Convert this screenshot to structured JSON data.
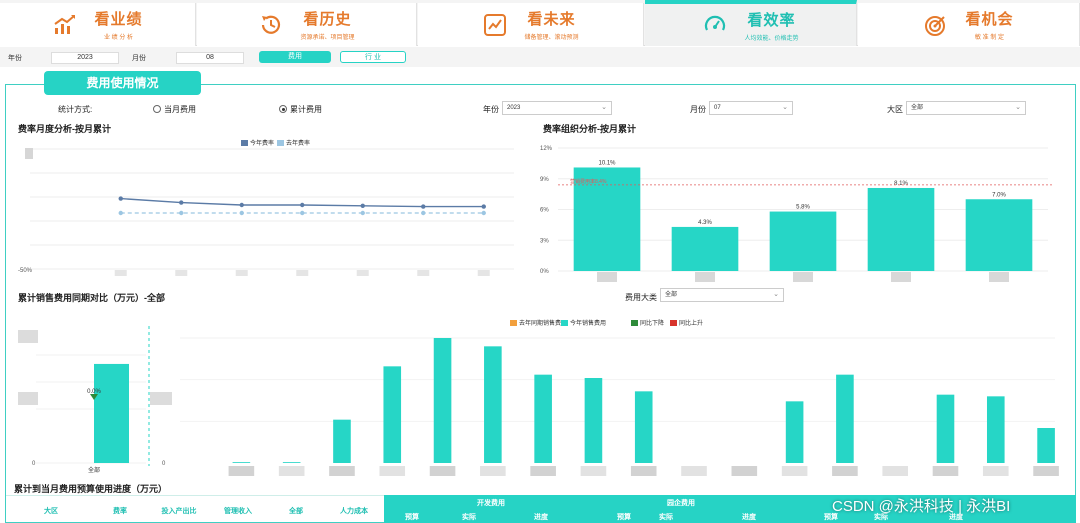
{
  "nav": {
    "tabs": [
      {
        "title": "看业绩",
        "subtitle": "业 绩 分 析",
        "icon": "bar-growth-icon",
        "active": false
      },
      {
        "title": "看历史",
        "subtitle": "资源承诺、项目管理",
        "icon": "history-icon",
        "active": false
      },
      {
        "title": "看未来",
        "subtitle": "储备管理、滚动预测",
        "icon": "trend-icon",
        "active": false
      },
      {
        "title": "看效率",
        "subtitle": "人均效能、价格走势",
        "icon": "gauge-icon",
        "active": true
      },
      {
        "title": "看机会",
        "subtitle": "敏 准 制 定",
        "icon": "target-icon",
        "active": false
      }
    ]
  },
  "filters": {
    "year_label": "年份",
    "year_value": "2023",
    "month_label": "月份",
    "month_value": "08",
    "btn_cost": "费用",
    "btn_industry": "行 业"
  },
  "panel": {
    "title": "费用使用情况",
    "stat_label": "统计方式:",
    "radio_month": "当月费用",
    "radio_cumulative": "累计费用",
    "year_label": "年份",
    "year_value": "2023",
    "month_label": "月份",
    "month_value": "07",
    "region_label": "大区",
    "region_value": "全部",
    "cost_cat_label": "费用大类",
    "cost_cat_value": "全部"
  },
  "sections": {
    "monthly_title": "费率月度分析-按月累计",
    "org_title": "费率组织分析-按月累计",
    "yoy_title": "累计销售费用同期对比（万元）-全部",
    "budget_title": "累计到当月费用预算使用进度（万元）"
  },
  "table": {
    "headers_white": [
      "大区",
      "费率",
      "投入产出比",
      "管理收入",
      "全部",
      "人力成本"
    ],
    "group1": "开发费用",
    "group2": "园企费用",
    "sub": [
      "预算",
      "实际",
      "进度",
      "预算",
      "实际",
      "进度",
      "预算",
      "实际",
      "进度"
    ]
  },
  "chart_data": [
    {
      "type": "line",
      "title": "费率月度分析-按月累计",
      "series": [
        {
          "name": "今年费率",
          "color": "#5b7ba6",
          "values": [
            null,
            0.38,
            0.33,
            0.3,
            0.3,
            0.29,
            0.28,
            0.28
          ]
        },
        {
          "name": "去年费率",
          "color": "#9cc6e2",
          "values": [
            null,
            0.2,
            0.2,
            0.2,
            0.2,
            0.2,
            0.2,
            0.2
          ]
        }
      ],
      "yticks_visible": [
        "-50%"
      ],
      "ylim": [
        -0.5,
        1
      ],
      "grid": true
    },
    {
      "type": "bar",
      "title": "费率组织分析-按月累计",
      "values": [
        10.1,
        4.3,
        5.8,
        8.1,
        7.0
      ],
      "labels": [
        "10.1%",
        "4.3%",
        "5.8%",
        "8.1%",
        "7.0%"
      ],
      "yticks": [
        "0%",
        "3%",
        "6%",
        "9%",
        "12%"
      ],
      "ylim": [
        0,
        12
      ],
      "ref_line": {
        "value": 8.4,
        "label": "营销费用率8.4%",
        "color": "#e05a5a"
      },
      "color": "#26d6c6"
    },
    {
      "type": "bar",
      "title": "累计销售费用同期对比（万元）-全部",
      "legend": [
        {
          "name": "去年同期销售费用",
          "color": "#f2a03d"
        },
        {
          "name": "今年销售费用",
          "color": "#26d6c6"
        },
        {
          "name": "同比下降",
          "color": "#2e8b3a"
        },
        {
          "name": "同比上升",
          "color": "#d8342c"
        }
      ],
      "left_panel": {
        "category": "全部",
        "value": 0.78,
        "pct_label": "0.0%",
        "ytick": "0"
      },
      "values": [
        0.005,
        0.005,
        0.26,
        0.58,
        0.75,
        0.7,
        0.53,
        0.51,
        0.43,
        0.0,
        0.0,
        0.37,
        0.53,
        0.0,
        0.41,
        0.4,
        0.21
      ],
      "ytick": "0",
      "color": "#26d6c6"
    }
  ],
  "watermark": "CSDN @永洪科技 | 永洪BI"
}
